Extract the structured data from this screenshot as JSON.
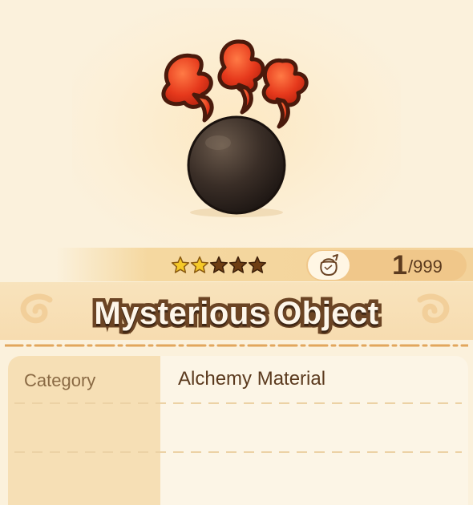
{
  "item": {
    "name": "Mysterious Object",
    "rarity": {
      "filled": 2,
      "total": 5
    },
    "owned": "1",
    "max": "/999",
    "art": "smoking-black-orb-icon"
  },
  "details": {
    "rows": [
      {
        "label": "Category",
        "value": "Alchemy Material"
      },
      {
        "label": "",
        "value": ""
      },
      {
        "label": "",
        "value": ""
      }
    ]
  },
  "colors": {
    "background": "#fbf1dc",
    "star_filled": "#f5c928",
    "star_empty": "#6e3e14",
    "title_outline": "#6b4424",
    "text_dark": "#5b3a1e",
    "label_text": "#8a6a44"
  }
}
